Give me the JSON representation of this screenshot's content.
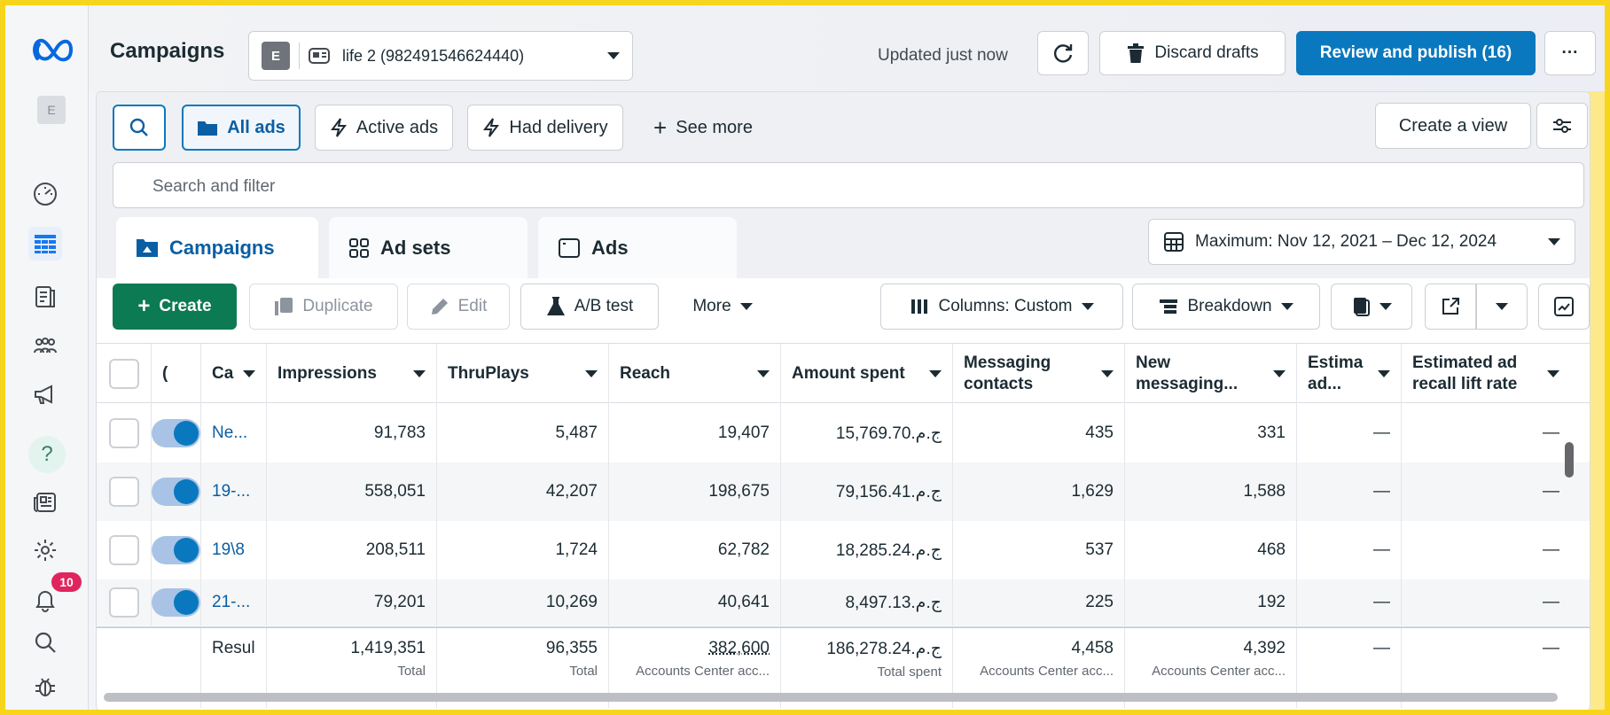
{
  "topbar": {
    "title": "Campaigns",
    "account_initial": "E",
    "account_name": "life 2 (982491546624440)",
    "updated": "Updated just now",
    "discard_label": "Discard drafts",
    "publish_label": "Review and publish (16)",
    "more_label": "···"
  },
  "rail": {
    "avatar_initial": "E",
    "notification_count": "10"
  },
  "filters": {
    "all_ads": "All ads",
    "active_ads": "Active ads",
    "had_delivery": "Had delivery",
    "see_more": "See more",
    "create_view": "Create a view",
    "search_placeholder": "Search and filter"
  },
  "tabs": {
    "campaigns": "Campaigns",
    "ad_sets": "Ad sets",
    "ads": "Ads"
  },
  "date_range": "Maximum: Nov 12, 2021 – Dec 12, 2024",
  "toolbar": {
    "create": "Create",
    "duplicate": "Duplicate",
    "edit": "Edit",
    "ab_test": "A/B test",
    "more": "More",
    "columns": "Columns: Custom",
    "breakdown": "Breakdown"
  },
  "table": {
    "headers": {
      "off_on": "(",
      "campaign": "Ca",
      "impressions": "Impressions",
      "thruplays": "ThruPlays",
      "reach": "Reach",
      "amount_spent": "Amount spent",
      "messaging_contacts": "Messaging contacts",
      "new_messaging": "New messaging...",
      "estima": "Estima ad...",
      "recall_lift": "Estimated ad recall lift rate"
    },
    "rows": [
      {
        "name": "Ne...",
        "impressions": "91,783",
        "thruplays": "5,487",
        "reach": "19,407",
        "amount": "ج.م.15,769.70",
        "contacts": "435",
        "new_contacts": "331",
        "estima": "—",
        "recall": "—"
      },
      {
        "name": "19-...",
        "impressions": "558,051",
        "thruplays": "42,207",
        "reach": "198,675",
        "amount": "ج.م.79,156.41",
        "contacts": "1,629",
        "new_contacts": "1,588",
        "estima": "—",
        "recall": "—"
      },
      {
        "name": "19\\8",
        "impressions": "208,511",
        "thruplays": "1,724",
        "reach": "62,782",
        "amount": "ج.م.18,285.24",
        "contacts": "537",
        "new_contacts": "468",
        "estima": "—",
        "recall": "—"
      },
      {
        "name": "21-...",
        "impressions": "79,201",
        "thruplays": "10,269",
        "reach": "40,641",
        "amount": "ج.م.8,497.13",
        "contacts": "225",
        "new_contacts": "192",
        "estima": "—",
        "recall": "—"
      }
    ],
    "totals": {
      "label": "Resul",
      "impressions": "1,419,351",
      "impressions_sub": "Total",
      "thruplays": "96,355",
      "thruplays_sub": "Total",
      "reach": "382,600",
      "reach_sub": "Accounts Center acc...",
      "amount": "ج.م.186,278.24",
      "amount_sub": "Total spent",
      "contacts": "4,458",
      "contacts_sub": "Accounts Center acc...",
      "new_contacts": "4,392",
      "new_contacts_sub": "Accounts Center acc...",
      "estima": "—",
      "recall": "—"
    }
  },
  "colors": {
    "primary": "#0a78be",
    "create_green": "#0c7a52",
    "link": "#0a5ea3",
    "frame": "#f7d51c"
  }
}
